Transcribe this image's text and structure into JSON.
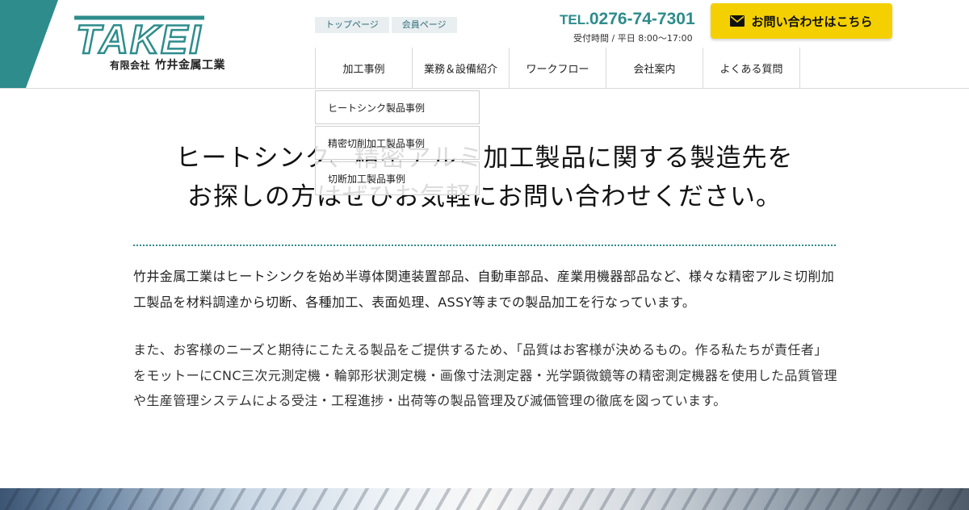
{
  "colors": {
    "accent": "#2e8c8c",
    "cta": "#f4d000"
  },
  "logo": {
    "wordmark": "TAKEI",
    "company_type": "有限会社",
    "company_name": "竹井金属工業"
  },
  "top_links": [
    "トップページ",
    "会員ページ"
  ],
  "contact": {
    "tel_prefix": "TEL.",
    "tel_number": "0276-74-7301",
    "hours": "受付時間 / 平日 8:00〜17:00",
    "cta_label": "お問い合わせはこちら",
    "cta_icon": "envelope-icon"
  },
  "nav": [
    "加工事例",
    "業務＆設備紹介",
    "ワークフロー",
    "会社案内",
    "よくある質問"
  ],
  "dropdown": [
    "ヒートシンク製品事例",
    "精密切削加工製品事例",
    "切断加工製品事例"
  ],
  "headline": {
    "line1": "ヒートシンク、精密アルミ加工製品に関する製造先を",
    "line2": "お探しの方はぜひお気軽にお問い合わせください。"
  },
  "paragraphs": [
    "竹井金属工業はヒートシンクを始め半導体関連装置部品、自動車部品、産業用機器部品など、様々な精密アルミ切削加工製品を材料調達から切断、各種加工、表面処理、ASSY等までの製品加工を行なっています。",
    "また、お客様のニーズと期待にこたえる製品をご提供するため、「品質はお客様が決めるもの。作る私たちが責任者」をモットーにCNC三次元測定機・輪郭形状測定機・画像寸法測定器・光学顕微鏡等の精密測定機器を使用した品質管理や生産管理システムによる受注・工程進捗・出荷等の製品管理及び滅価管理の徹底を図っています。"
  ]
}
